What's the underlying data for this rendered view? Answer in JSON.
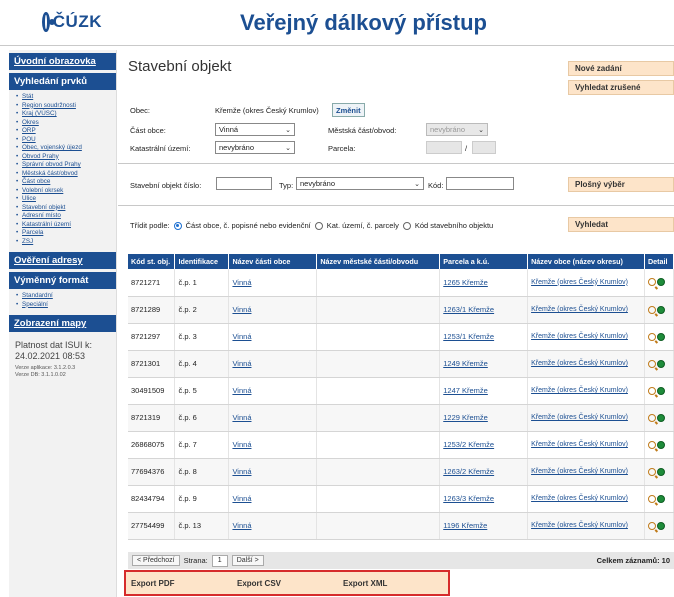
{
  "header": {
    "logo_text": "ČÚZK",
    "title": "Veřejný dálkový přístup"
  },
  "sidebar": {
    "home": "Úvodní obrazovka",
    "search_head": "Vyhledání prvků",
    "search_items": [
      "Stát",
      "Region soudržnosti",
      "Kraj (VÚSC)",
      "Okres",
      "ORP",
      "POU",
      "Obec, vojenský újezd",
      "Obvod Prahy",
      "Správní obvod Prahy",
      "Městská část/obvod",
      "Část obce",
      "Volební okrsek",
      "Ulice",
      "Stavební objekt",
      "Adresní místo",
      "Katastrální území",
      "Parcela",
      "ZSJ"
    ],
    "verify_head": "Ověření adresy",
    "exchange_head": "Výměnný formát",
    "exchange_items": [
      "Standardní",
      "Speciální"
    ],
    "map_head": "Zobrazení mapy",
    "validity_label": "Platnost dat ISUI k:",
    "validity_date": "24.02.2021 08:53",
    "version_app": "Verze aplikace: 3.1.2.0.3",
    "version_db": "Verze DB: 3.1.1.0.02"
  },
  "main": {
    "page_title": "Stavební objekt",
    "new_search": "Nové zadání",
    "search_cancelled": "Vyhledat zrušené",
    "obec_label": "Obec:",
    "obec_value": "Křemže (okres Český Krumlov)",
    "change_button": "Změnit",
    "cast_obce_label": "Část obce:",
    "cast_obce_value": "Vinná",
    "mestska_cast_label": "Městská část/obvod:",
    "mestska_cast_value": "nevybráno",
    "kat_uzemi_label": "Katastrální území:",
    "kat_uzemi_value": "nevybráno",
    "parcela_label": "Parcela:",
    "parcela_sep": "/",
    "so_cislo_label": "Stavební objekt číslo:",
    "typ_label": "Typ:",
    "typ_value": "nevybráno",
    "kod_label": "Kód:",
    "area_select": "Plošný výběr",
    "sort_label": "Třídit podle:",
    "sort_opt1": "Část obce, č. popisné nebo evidenční",
    "sort_opt2": "Kat. území, č. parcely",
    "sort_opt3": "Kód stavebního objektu",
    "search_button": "Vyhledat"
  },
  "table": {
    "headers": [
      "Kód st. obj.",
      "Identifikace",
      "Název části obce",
      "Název městské části/obvodu",
      "Parcela a k.ú.",
      "Název obce (název okresu)",
      "Detail"
    ],
    "rows": [
      [
        "8721271",
        "č.p. 1",
        "Vinná",
        "",
        "1265 Křemže",
        "Křemže (okres Český Krumlov)"
      ],
      [
        "8721289",
        "č.p. 2",
        "Vinná",
        "",
        "1263/1 Křemže",
        "Křemže (okres Český Krumlov)"
      ],
      [
        "8721297",
        "č.p. 3",
        "Vinná",
        "",
        "1253/1 Křemže",
        "Křemže (okres Český Krumlov)"
      ],
      [
        "8721301",
        "č.p. 4",
        "Vinná",
        "",
        "1249 Křemže",
        "Křemže (okres Český Krumlov)"
      ],
      [
        "30491509",
        "č.p. 5",
        "Vinná",
        "",
        "1247 Křemže",
        "Křemže (okres Český Krumlov)"
      ],
      [
        "8721319",
        "č.p. 6",
        "Vinná",
        "",
        "1229 Křemže",
        "Křemže (okres Český Krumlov)"
      ],
      [
        "26868075",
        "č.p. 7",
        "Vinná",
        "",
        "1253/2 Křemže",
        "Křemže (okres Český Krumlov)"
      ],
      [
        "77694376",
        "č.p. 8",
        "Vinná",
        "",
        "1263/2 Křemže",
        "Křemže (okres Český Krumlov)"
      ],
      [
        "82434794",
        "č.p. 9",
        "Vinná",
        "",
        "1263/3 Křemže",
        "Křemže (okres Český Krumlov)"
      ],
      [
        "27754499",
        "č.p. 13",
        "Vinná",
        "",
        "1196 Křemže",
        "Křemže (okres Český Krumlov)"
      ]
    ]
  },
  "pager": {
    "prev": "< Předchozí",
    "page_label": "Strana:",
    "page_value": "1",
    "next": "Další >",
    "records": "Celkem záznamů: 10"
  },
  "export": {
    "pdf": "Export PDF",
    "csv": "Export CSV",
    "xml": "Export XML"
  },
  "colors": {
    "brand": "#1c4f92",
    "button_bg": "#fde4c9",
    "highlight": "#d62b2b"
  }
}
